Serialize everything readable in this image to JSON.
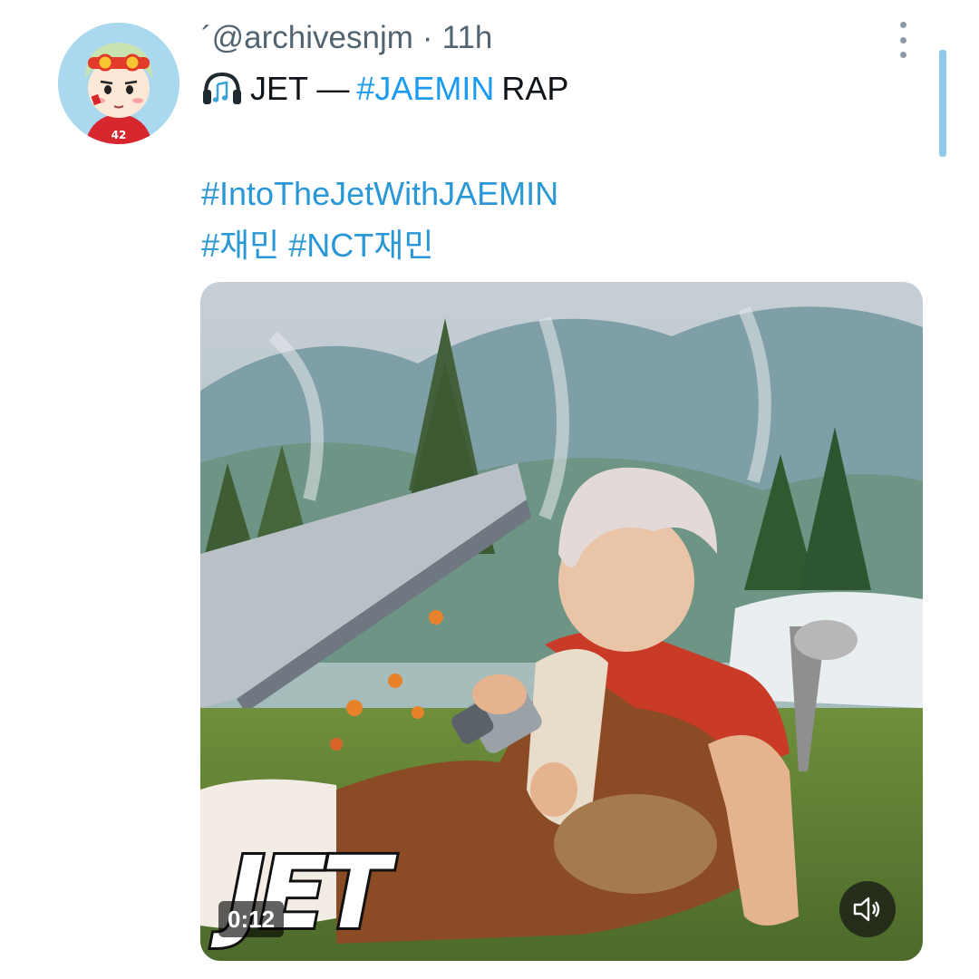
{
  "tweet": {
    "handle": "´@archivesnjm",
    "separator": "·",
    "time": "11h",
    "line1": {
      "icon": "headphones-music-icon",
      "prefix": "JET —",
      "hashtag": "#JAEMIN",
      "suffix": "RAP"
    },
    "hashtags_line2": "#IntoTheJetWithJAEMIN",
    "hashtags_line3": [
      "#재민",
      "#NCT재민"
    ]
  },
  "media": {
    "type": "video",
    "overlay_logo": "JET",
    "timestamp": "0:12",
    "mute_icon": "speaker-muted-icon"
  },
  "colors": {
    "link": "#1d9bf0",
    "text": "#0f1419",
    "muted": "#536471",
    "scroll_indicator": "#8ec9ec"
  }
}
